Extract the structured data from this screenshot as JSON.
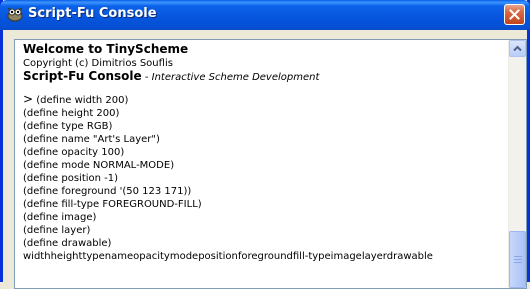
{
  "window": {
    "title": "Script-Fu Console"
  },
  "icons": {
    "app": "gimp-wilber-icon",
    "close": "close-icon",
    "scroll_up": "scroll-up-arrow-icon"
  },
  "colors": {
    "titlebar": "#0755dd",
    "close_button": "#d86a47",
    "console_background": "#ffffff"
  },
  "console": {
    "welcome": "Welcome to TinyScheme",
    "copyright": "Copyright (c) Dimitrios Souflis",
    "heading": "Script-Fu Console",
    "heading_separator": " - ",
    "subtitle": "Interactive Scheme Development",
    "prompt": ">",
    "lines": [
      "(define width 200)",
      "(define height 200)",
      "(define type RGB)",
      "(define name \"Art's Layer\")",
      "(define opacity 100)",
      "(define mode NORMAL-MODE)",
      "(define position -1)",
      "(define foreground '(50 123 171))",
      "(define fill-type FOREGROUND-FILL)",
      "(define image)",
      "(define layer)",
      "(define drawable)"
    ],
    "output": "widthheighttypenameopacitymodepositionforegroundfill-typeimagelayerdrawable"
  }
}
